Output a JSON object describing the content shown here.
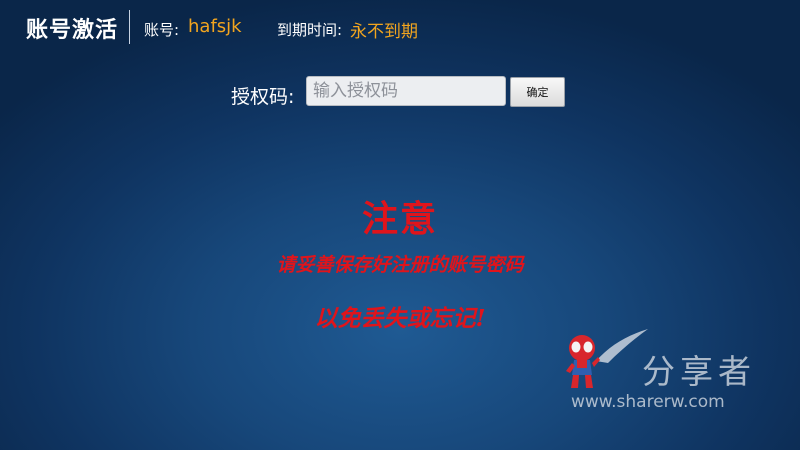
{
  "header": {
    "title": "账号激活",
    "account_label": "账号:",
    "account_value": "hafsjk",
    "expiry_label": "到期时间:",
    "expiry_value": "永不到期"
  },
  "auth": {
    "label": "授权码:",
    "placeholder": "输入授权码",
    "value": "",
    "confirm_label": "确定"
  },
  "notice": {
    "title": "注意",
    "line1": "请妥善保存好注册的账号密码",
    "line2": "以免丢失或忘记!"
  },
  "watermark": {
    "name": "分享者",
    "url": "www.sharerw.com",
    "mascot_icon": "spiderman-mascot-icon"
  },
  "colors": {
    "accent": "#f2a51f",
    "warning": "#e0141b",
    "background_center": "#1f5a93",
    "background_edge": "#0a2649"
  }
}
